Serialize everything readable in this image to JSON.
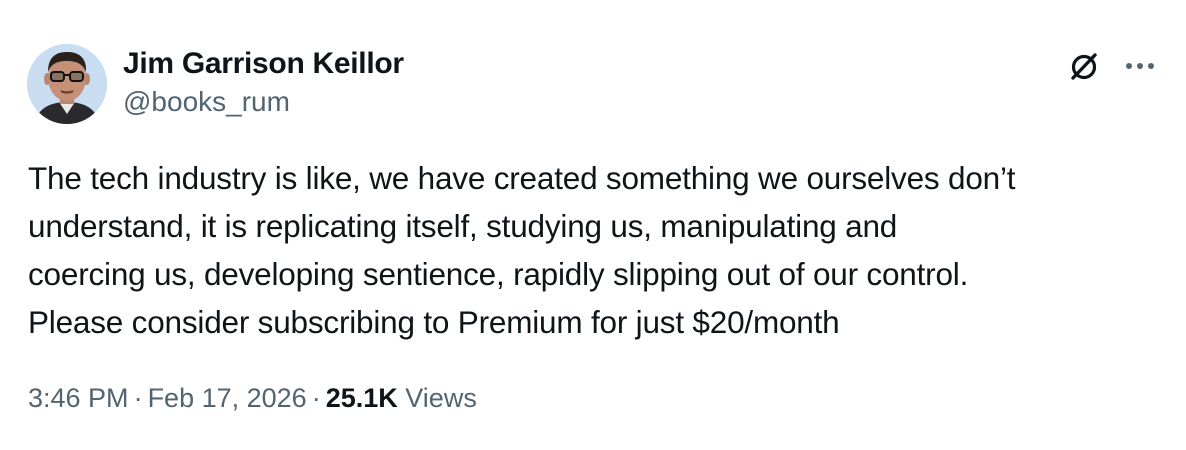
{
  "author": {
    "display_name": "Jim Garrison Keillor",
    "handle": "@books_rum",
    "avatar_icon": "profile-photo-man-with-glasses"
  },
  "header_icons": {
    "grok": "grok-slash-circle-icon",
    "more": "more-horizontal-icon"
  },
  "tweet": {
    "text": "The tech industry is like, we have created something we ourselves don’t\nunderstand, it is replicating itself, studying us, manipulating and\ncoercing us, developing sentience, rapidly slipping out of our control.\nPlease consider subscribing to Premium for just $20/month"
  },
  "meta": {
    "time": "3:46 PM",
    "separator": "·",
    "date": "Feb 17, 2026",
    "views_count": "25.1K",
    "views_label": "Views"
  },
  "colors": {
    "text_primary": "#0f1419",
    "text_secondary": "#536471",
    "background": "#ffffff"
  }
}
